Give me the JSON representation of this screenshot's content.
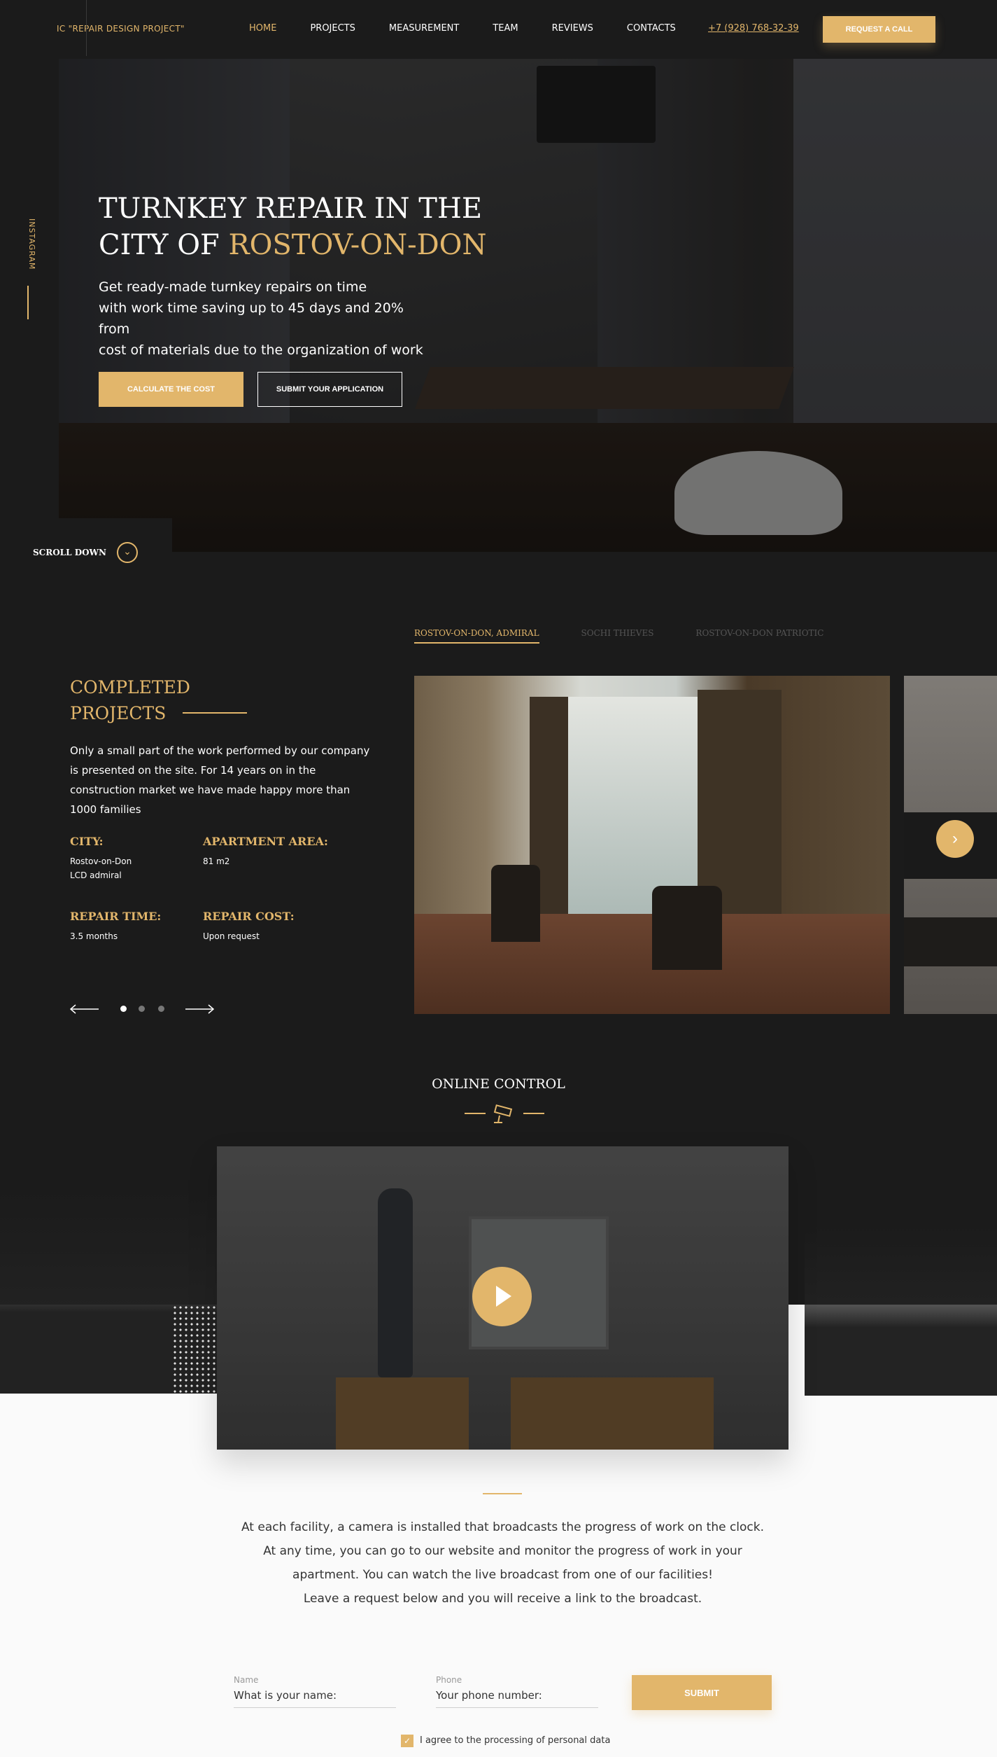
{
  "header": {
    "logo": "IC \"REPAIR DESIGN PROJECT\"",
    "nav": [
      {
        "label": "HOME",
        "active": true
      },
      {
        "label": "PROJECTS"
      },
      {
        "label": "MEASUREMENT"
      },
      {
        "label": "TEAM"
      },
      {
        "label": "REVIEWS"
      },
      {
        "label": "CONTACTS"
      }
    ],
    "phone": "+7 (928) 768-32-39",
    "call_button": "REQUEST A CALL"
  },
  "sidebar": {
    "instagram": "INSTAGRAM"
  },
  "hero": {
    "title_part1": "TURNKEY REPAIR IN THE",
    "title_part2": "CITY OF ",
    "title_highlight": "ROSTOV-ON-DON",
    "text_line1": "Get ready-made turnkey repairs on time",
    "text_line2": "with work time saving up to 45 days and 20% from",
    "text_line3": "cost of materials due to the organization of work",
    "calc_button": "CALCULATE THE COST",
    "submit_button": "SUBMIT YOUR APPLICATION",
    "scroll_label": "SCROLL DOWN"
  },
  "projects": {
    "tabs": [
      {
        "label": "ROSTOV-ON-DON, ADMIRAL",
        "active": true
      },
      {
        "label": "SOCHI THIEVES"
      },
      {
        "label": "ROSTOV-ON-DON PATRIOTIC"
      }
    ],
    "title_line1": "COMPLETED",
    "title_line2": "PROJECTS",
    "description": "Only a small part of the work performed by our company is presented on the site. For 14 years on in the construction market we have made happy more than 1000 families",
    "city_label": "CITY:",
    "city_value_line1": "Rostov-on-Don",
    "city_value_line2": "LCD admiral",
    "area_label": "APARTMENT AREA:",
    "area_value": "81 m2",
    "time_label": "REPAIR TIME:",
    "time_value": "3.5 months",
    "cost_label": "REPAIR COST:",
    "cost_value": "Upon request",
    "slider": {
      "current": 1,
      "total": 3
    }
  },
  "online_control": {
    "title": "ONLINE CONTROL",
    "text_line1": "At each facility, a camera is installed that broadcasts the progress of work on the clock.",
    "text_line2": "At any time, you can go to our website and monitor the progress of work in your",
    "text_line3": "apartment. You can watch the live broadcast from one of our facilities!",
    "text_line4": "Leave a request below and you will receive a link to the broadcast."
  },
  "form": {
    "name_label": "Name",
    "name_placeholder": "What is your name:",
    "phone_label": "Phone",
    "phone_placeholder": "Your phone number:",
    "submit": "SUBMIT",
    "agree_text": "I agree to the processing of personal data",
    "agree_checked": true
  },
  "colors": {
    "accent": "#e2b66b",
    "background_dark": "#1b1b1b",
    "background_light": "#fafafa"
  }
}
